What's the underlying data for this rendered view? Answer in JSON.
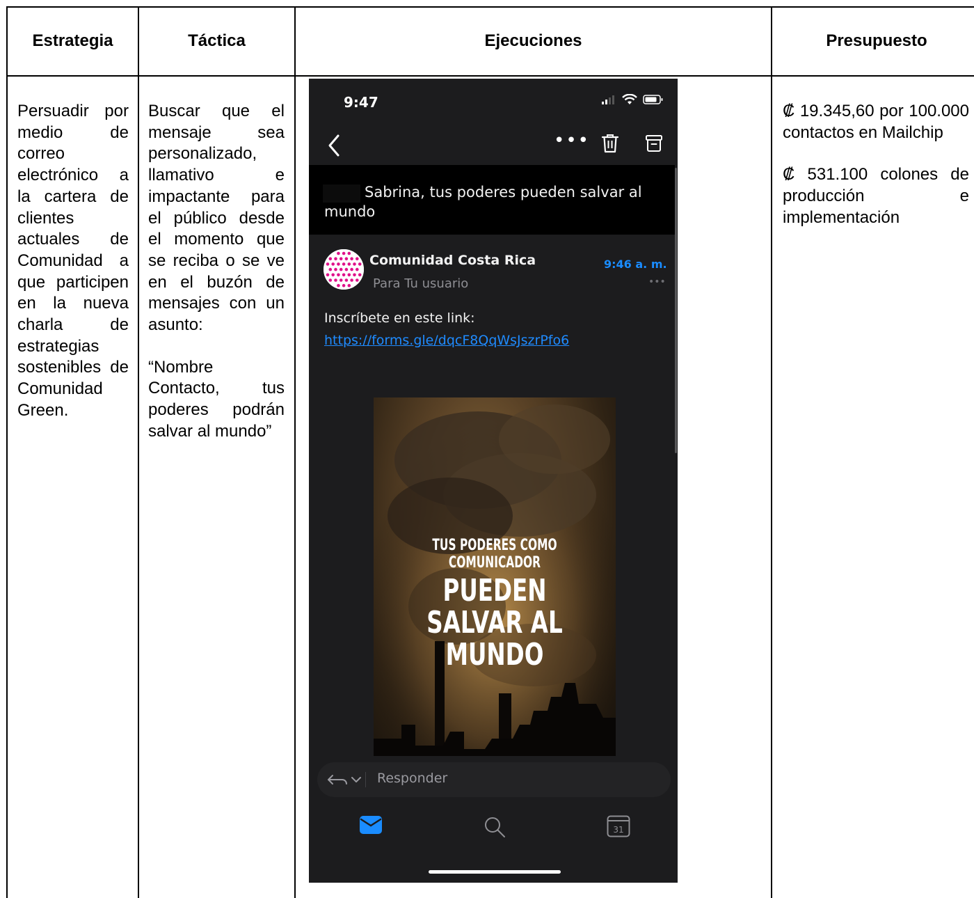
{
  "headers": {
    "strategy": "Estrategia",
    "tactic": "Táctica",
    "executions": "Ejecuciones",
    "budget": "Presupuesto"
  },
  "strategy_text": "Persuadir por medio de correo electrónico a la cartera de clientes actuales de Comunidad a que participen en la nueva charla de estrategias sostenibles de Comunidad Green.",
  "tactic_text": "Buscar que el mensaje sea personalizado, llamativo e impactante para el público desde el momento que se reciba o se ve en el buzón de mensajes con un asunto:",
  "tactic_quote": "“Nombre Contacto, tus poderes podrán salvar al mundo”",
  "budget_items": [
    "₡ 19.345,60 por 100.000 contactos en Mailchip",
    "₡ 531.100 colones de producción e implementación"
  ],
  "phone": {
    "time": "9:47",
    "subject": "Sabrina, tus poderes pueden salvar al mundo",
    "sender": "Comunidad Costa Rica",
    "sender_time": "9:46 a. m.",
    "recipient": "Para Tu usuario",
    "body_text": "Inscríbete en este link:",
    "link": "https://forms.gle/dqcF8QqWsJszrPfo6",
    "poster_small": "TUS PODERES COMO COMUNICADOR",
    "poster_big": "PUEDEN SALVAR AL MUNDO",
    "reply_placeholder": "Responder",
    "calendar_day": "31",
    "accent_color": "#1a8cff"
  }
}
